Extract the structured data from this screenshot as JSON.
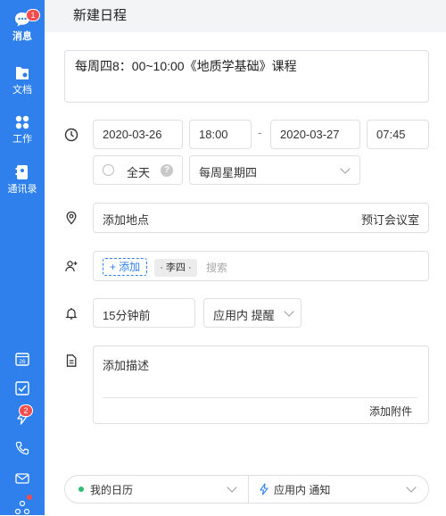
{
  "nav": {
    "items": [
      {
        "label": "消息",
        "badge": "1"
      },
      {
        "label": "文档"
      },
      {
        "label": "工作"
      },
      {
        "label": "通讯录"
      }
    ],
    "bottom_badge": "2"
  },
  "header": {
    "title": "新建日程"
  },
  "event": {
    "title": "每周四8：00~10:00《地质学基础》课程",
    "start_date": "2020-03-26",
    "start_time": "18:00",
    "dash": "-",
    "end_date": "2020-03-27",
    "end_time": "07:45",
    "all_day_label": "全天",
    "help_glyph": "?",
    "repeat": "每周星期四",
    "location_placeholder": "添加地点",
    "book_room": "预订会议室",
    "add_attendee": "+ 添加",
    "attendee_chip": "· 李四 ·",
    "search_placeholder": "搜索",
    "reminder": "15分钟前",
    "reminder_type": "应用内 提醒",
    "description_placeholder": "添加描述",
    "add_attachment": "添加附件"
  },
  "footer": {
    "calendar": "我的日历",
    "notify": "应用内 通知"
  },
  "colors": {
    "accent": "#2f80ed",
    "badge": "#f24c4c",
    "calendar_dot": "#2dbd6e"
  }
}
